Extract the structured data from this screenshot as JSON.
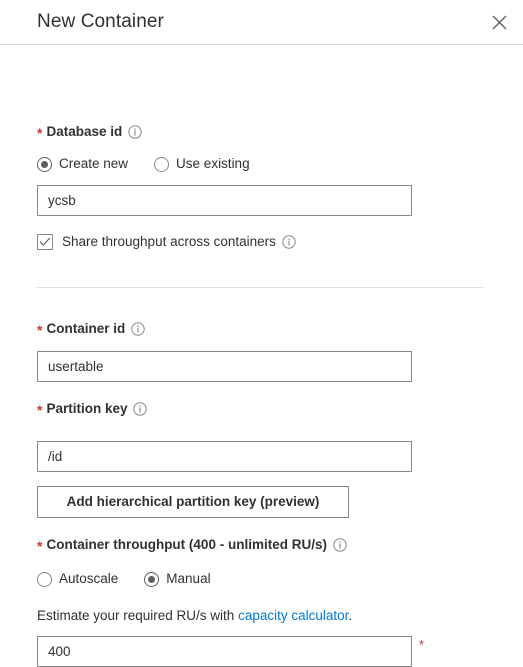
{
  "header": {
    "title": "New Container",
    "close_icon": "close-icon"
  },
  "form": {
    "database_id": {
      "label": "Database id",
      "required_marker": "*",
      "info_icon": "info-icon",
      "mode_options": [
        {
          "label": "Create new",
          "selected": true
        },
        {
          "label": "Use existing",
          "selected": false
        }
      ],
      "value": "ycsb",
      "share_throughput": {
        "label": "Share throughput across containers",
        "checked": true,
        "info_icon": "info-icon"
      }
    },
    "container_id": {
      "label": "Container id",
      "required_marker": "*",
      "info_icon": "info-icon",
      "value": "usertable"
    },
    "partition_key": {
      "label": "Partition key",
      "required_marker": "*",
      "info_icon": "info-icon",
      "value": "/id",
      "add_hierarchical_button": "Add hierarchical partition key (preview)"
    },
    "throughput": {
      "label": "Container throughput (400 - unlimited RU/s)",
      "required_marker": "*",
      "info_icon": "info-icon",
      "mode_options": [
        {
          "label": "Autoscale",
          "selected": false
        },
        {
          "label": "Manual",
          "selected": true
        }
      ],
      "hint_prefix": "Estimate your required RU/s with ",
      "hint_link": "capacity calculator",
      "hint_suffix": ".",
      "value": "400",
      "required_marker_trailing": "*"
    }
  },
  "colors": {
    "accent_link": "#0078d4",
    "required_red": "#d13438",
    "text": "#323130",
    "border": "#8a8886",
    "divider": "#e1dfdd"
  }
}
